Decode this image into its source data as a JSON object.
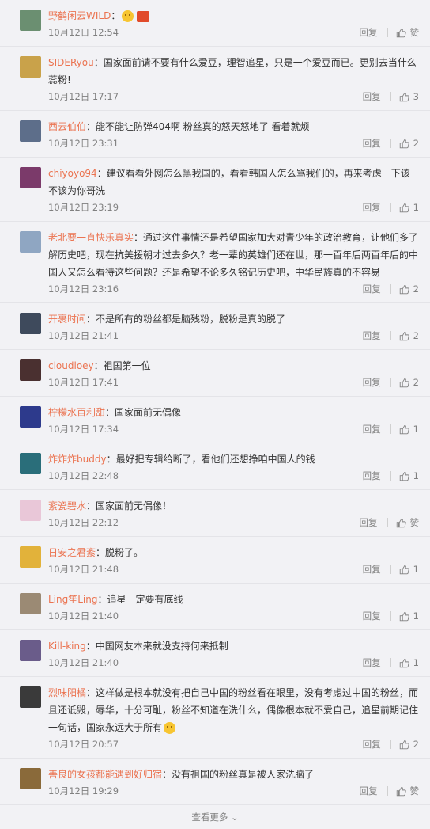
{
  "colors": {
    "name": "#eb7350",
    "time": "#808080",
    "background": "#f2f2f5"
  },
  "actions": {
    "reply_label": "回复",
    "like_icon": "thumbs-up-icon"
  },
  "comments": [
    {
      "user": "野鹤闲云WILD",
      "sep": "：",
      "text": "",
      "extra": "emoji+badge",
      "time": "10月12日 12:54",
      "likes": "赞",
      "avatar_color": "#6b8f71"
    },
    {
      "user": "SIDERyou",
      "sep": "：",
      "text": "国家面前请不要有什么爱豆，理智追星，只是一个爱豆而已。更别去当什么蕊粉!",
      "time": "10月12日 17:17",
      "likes": "3",
      "avatar_color": "#c9a24a"
    },
    {
      "user": "西云伯伯",
      "sep": "：",
      "text": "能不能让防弹404啊 粉丝真的怒天怒地了 看着就烦",
      "time": "10月12日 23:31",
      "likes": "2",
      "avatar_color": "#5d6e8a"
    },
    {
      "user": "chiyoyo94",
      "sep": "：",
      "text": "建议看看外网怎么黑我国的，看看韩国人怎么骂我们的，再来考虑一下该不该为你哥洗",
      "time": "10月12日 23:19",
      "likes": "1",
      "avatar_color": "#7b3a6a"
    },
    {
      "user": "老北要一直快乐真实",
      "sep": "：",
      "text": "通过这件事情还是希望国家加大对青少年的政治教育，让他们多了解历史吧，现在抗美援朝才过去多久？老一辈的英雄们还在世，那一百年后两百年后的中国人又怎么看待这些问题？还是希望不论多久铭记历史吧，中华民族真的不容易",
      "time": "10月12日 23:16",
      "likes": "2",
      "avatar_color": "#8fa6c2"
    },
    {
      "user": "开裹时间",
      "sep": "：",
      "text": "不是所有的粉丝都是脑残粉，脱粉是真的脱了",
      "time": "10月12日 21:41",
      "likes": "2",
      "avatar_color": "#3e4a5c"
    },
    {
      "user": "cloudloey",
      "sep": "：",
      "text": "祖国第一位",
      "time": "10月12日 17:41",
      "likes": "2",
      "avatar_color": "#4a3030"
    },
    {
      "user": "柠檬水百利甜",
      "sep": "：",
      "text": "国家面前无偶像",
      "time": "10月12日 17:34",
      "likes": "1",
      "avatar_color": "#2d3a8c"
    },
    {
      "user": "炸炸炸buddy",
      "sep": "：",
      "text": "最好把专辑给断了，看他们还想挣咱中国人的钱",
      "time": "10月12日 22:48",
      "likes": "1",
      "avatar_color": "#2a6e7a"
    },
    {
      "user": "紊瓷碧水",
      "sep": "：",
      "text": "国家面前无偶像！",
      "time": "10月12日 22:12",
      "likes": "赞",
      "avatar_color": "#e9c7d8"
    },
    {
      "user": "日安之君紊",
      "sep": "：",
      "text": "脱粉了。",
      "time": "10月12日 21:48",
      "likes": "1",
      "avatar_color": "#e2b23a"
    },
    {
      "user": "Ling笙Ling",
      "sep": "：",
      "text": "追星一定要有底线",
      "time": "10月12日 21:40",
      "likes": "1",
      "avatar_color": "#9b8a74"
    },
    {
      "user": "Kill-king",
      "sep": "：",
      "text": "中国网友本来就没支持何来抵制",
      "time": "10月12日 21:40",
      "likes": "1",
      "avatar_color": "#6a5c8a"
    },
    {
      "user": "烈味阳橘",
      "sep": "：",
      "text": "这样做是根本就没有把自己中国的粉丝看在眼里，没有考虑过中国的粉丝，而且还诋毁，辱华，十分可耻，粉丝不知道在洗什么，偶像根本就不爱自己，追星前期记住一句话，国家永远大于所有",
      "extra": "emoji",
      "time": "10月12日 20:57",
      "likes": "2",
      "avatar_color": "#3a3a3a"
    },
    {
      "user": "善良的女孩都能遇到好归宿",
      "sep": "：",
      "text": "没有祖国的粉丝真是被人家洗脑了",
      "time": "10月12日 19:29",
      "likes": "赞",
      "avatar_color": "#8a6a3a"
    }
  ],
  "footer": {
    "more_label": "查看更多 ⌄"
  }
}
